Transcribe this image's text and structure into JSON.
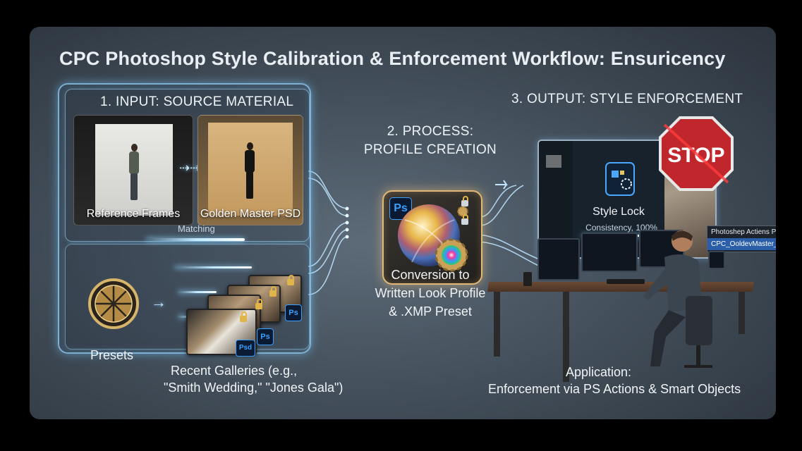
{
  "title": "CPC Photoshop Style Calibration & Enforcement Workflow: Ensuricency",
  "input": {
    "header": "1. INPUT: SOURCE MATERIAL",
    "reference_caption": "Reference Frames",
    "golden_caption": "Golden Master PSD",
    "matching_label": "Matching",
    "presets_label": "Presets",
    "galleries_line1": "Recent Galleries (e.g.,",
    "galleries_line2": "\"Smith Wedding,\" \"Jones Gala\")",
    "badge_ps": "Ps",
    "badge_psd": "Psd"
  },
  "process": {
    "header_line1": "2. PROCESS:",
    "header_line2": "PROFILE CREATION",
    "badge": "Ps",
    "caption_line1": "Conversion to",
    "caption_line2": "Written Look Profile",
    "caption_line3": "& .XMP Preset"
  },
  "output": {
    "header": "3. OUTPUT: STYLE ENFORCEMENT",
    "style_lock": "Style Lock",
    "consistency": "Consistency, 100%",
    "stop_sign": "STOP",
    "actions_panel_title": "Photoshep Actiens Panel",
    "actions_panel_item": "CPC_OoldevMaster_Lock",
    "application_line1": "Application:",
    "application_line2": "Enforcement via PS Actions & Smart Objects"
  },
  "colors": {
    "glow": "#8fd3ff",
    "process_border": "#e0b978",
    "stop_red": "#c0272d",
    "ps_blue": "#3aa0ff"
  }
}
